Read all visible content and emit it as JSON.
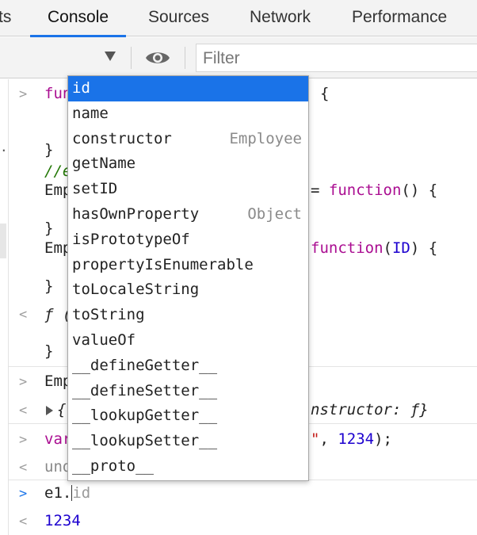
{
  "tabs": [
    {
      "label": "ts"
    },
    {
      "label": "Console"
    },
    {
      "label": "Sources"
    },
    {
      "label": "Network"
    },
    {
      "label": "Performance"
    }
  ],
  "active_tab": "Console",
  "toolbar": {
    "context_arrow_icon": "triangle-down-icon",
    "eye_icon": "eye-icon",
    "filter_placeholder": "Filter"
  },
  "colors": {
    "accent": "#1a73e8",
    "keyword": "#aa0d91",
    "number": "#1c00cf",
    "string": "#c41a16",
    "comment": "#237806",
    "suggestion_type": "#8a8a8a"
  },
  "console": {
    "entries": [
      {
        "prompt": ">",
        "segments": [
          {
            "text": "fun"
          },
          {
            "text": "{",
            "offset": true
          }
        ]
      },
      {
        "text": "}"
      },
      {
        "text": "//e"
      },
      {
        "segments": [
          {
            "text": "Emp"
          },
          {
            "text": "= "
          },
          {
            "text": "function"
          },
          {
            "text": "() {"
          }
        ]
      },
      {
        "text": "}"
      },
      {
        "segments": [
          {
            "text": "Emp"
          },
          {
            "text": "function"
          },
          {
            "text": "("
          },
          {
            "text": "ID"
          },
          {
            "text": ") {"
          }
        ]
      },
      {
        "text": "}"
      },
      {
        "prompt": "<",
        "segments": [
          {
            "text": "ƒ ("
          }
        ]
      },
      {
        "text": "}"
      },
      {
        "prompt": ">",
        "text": "Emp"
      },
      {
        "prompt": "<",
        "segments": [
          {
            "text": "{"
          },
          {
            "text": "nstructor: ƒ}"
          }
        ]
      },
      {
        "prompt": ">",
        "segments": [
          {
            "text": "var"
          },
          {
            "text": "\""
          },
          {
            "text": ", "
          },
          {
            "text": "1234"
          },
          {
            "text": ");"
          }
        ]
      },
      {
        "prompt": "<",
        "text": "und"
      },
      {
        "prompt": ">",
        "input": "e1.",
        "ghost": "id"
      },
      {
        "prompt": "<",
        "result": "1234"
      }
    ]
  },
  "suggestions": [
    {
      "label": "id",
      "selected": true
    },
    {
      "label": "name"
    },
    {
      "label": "constructor",
      "type": "Employee"
    },
    {
      "label": "getName"
    },
    {
      "label": "setID"
    },
    {
      "label": "hasOwnProperty",
      "type": "Object"
    },
    {
      "label": "isPrototypeOf"
    },
    {
      "label": "propertyIsEnumerable"
    },
    {
      "label": "toLocaleString"
    },
    {
      "label": "toString"
    },
    {
      "label": "valueOf"
    },
    {
      "label": "__defineGetter__"
    },
    {
      "label": "__defineSetter__"
    },
    {
      "label": "__lookupGetter__"
    },
    {
      "label": "__lookupSetter__"
    },
    {
      "label": "__proto__"
    }
  ]
}
